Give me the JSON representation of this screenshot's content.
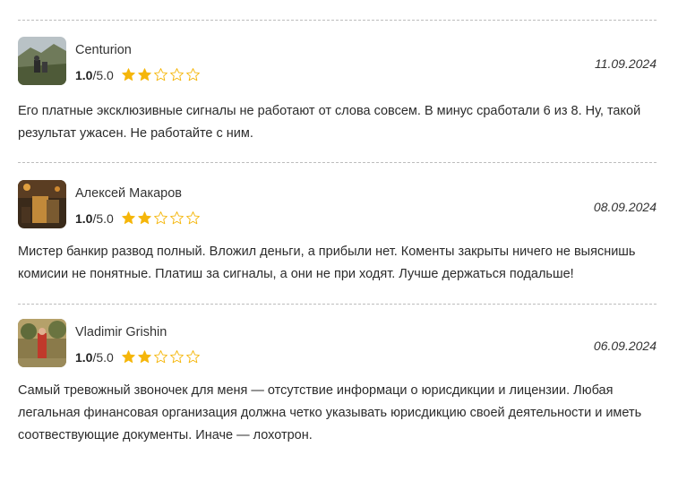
{
  "reviews": [
    {
      "author": "Centurion",
      "score": "1.0",
      "score_max": "/5.0",
      "stars_filled": 2,
      "stars_total": 5,
      "date": "11.09.2024",
      "text": "Его платные эксклюзивные сигналы не работают от слова совсем. В минус сработали 6 из 8. Ну, такой результат ужасен. Не работайте с ним."
    },
    {
      "author": "Алексей Макаров",
      "score": "1.0",
      "score_max": "/5.0",
      "stars_filled": 2,
      "stars_total": 5,
      "date": "08.09.2024",
      "text": "Мистер банкир развод полный. Вложил деньги, а прибыли нет. Коменты закрыты ничего не выяснишь комисии не понятные. Платиш за сигналы, а они не при ходят. Лучше держаться подальше!"
    },
    {
      "author": "Vladimir Grishin",
      "score": "1.0",
      "score_max": "/5.0",
      "stars_filled": 2,
      "stars_total": 5,
      "date": "06.09.2024",
      "text": "Самый тревожный звоночек для меня — отсутствие информаци о юрисдикции и лицензии. Любая легальная финансовая организация должна четко указывать юрисдикцию своей деятельности и иметь соотвествующие документы. Иначе — лохотрон."
    }
  ],
  "colors": {
    "star_filled": "#f5b60a",
    "star_empty_stroke": "#f5b60a",
    "divider": "#bdbdbd"
  }
}
